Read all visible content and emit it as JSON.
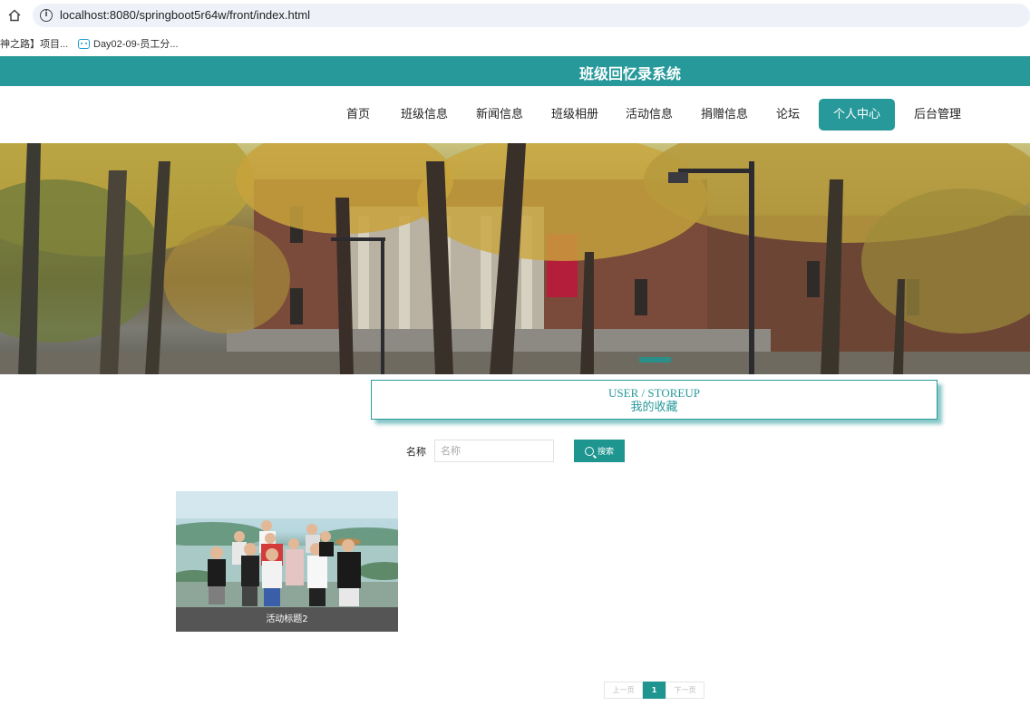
{
  "browser": {
    "url": "localhost:8080/springboot5r64w/front/index.html",
    "bookmarks": [
      "神之路】项目...",
      "Day02-09-员工分..."
    ]
  },
  "header": {
    "title": "班级回忆录系统"
  },
  "nav": {
    "items": [
      "首页",
      "班级信息",
      "新闻信息",
      "班级相册",
      "活动信息",
      "捐赠信息",
      "论坛",
      "个人中心",
      "后台管理"
    ],
    "active": "个人中心"
  },
  "section": {
    "title_en": "USER / STOREUP",
    "title_zh": "我的收藏"
  },
  "search": {
    "label": "名称",
    "placeholder": "名称",
    "button_label": "搜索"
  },
  "cards": [
    {
      "title": "活动标题2"
    }
  ],
  "pagination": {
    "prev": "上一页",
    "current": "1",
    "next": "下一页"
  },
  "colors": {
    "accent": "#28999a",
    "button": "#1f9590",
    "card_caption_bg": "#555555"
  },
  "icons": {
    "home": "home-icon",
    "info": "info-icon",
    "bookmark": "bilibili-icon",
    "search": "search-icon"
  }
}
